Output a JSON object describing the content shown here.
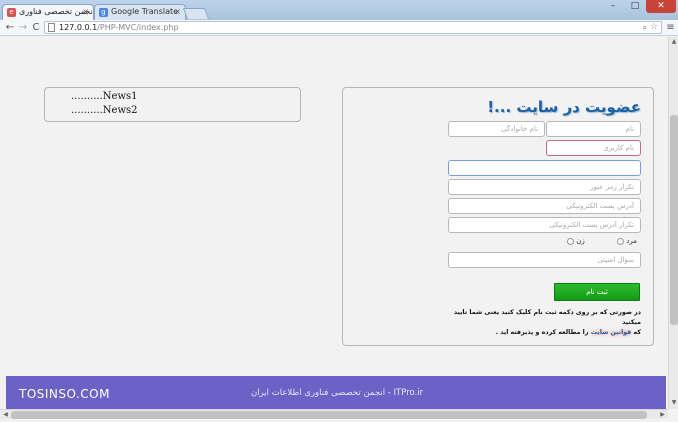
{
  "browser": {
    "tabs": [
      {
        "title": "انجمن تخصصی فناوری",
        "close": "×",
        "favicon": "e",
        "favicon_color": "#d9534f"
      },
      {
        "title": "Google Translate",
        "close": "×",
        "favicon": "g",
        "favicon_color": "#4a86e8"
      }
    ],
    "address_host": "127.0.0.1",
    "address_path": "/PHP-MVC/index.php",
    "nav": {
      "back": "←",
      "forward": "→",
      "reload": "C"
    },
    "window": {
      "minimize": "–",
      "maximize": "□",
      "close": "✕"
    },
    "menu_icon": "≡",
    "zoom_icon": "⌕",
    "star_icon": "☆"
  },
  "news": {
    "items": [
      "..........News1",
      "..........News2"
    ]
  },
  "register": {
    "title": "عضویت در سایت ...!",
    "placeholders": {
      "name": "نام",
      "family": "نام خانوادگی",
      "username": "نام کاربری",
      "password": "",
      "password_repeat": "تکرار رمز عبور",
      "email": "آدرس پست الکترونیکی",
      "email_repeat": "تکرار آدرس پست الکترونیکی",
      "security_question": "سوال امنیتی"
    },
    "gender": {
      "male": "مرد",
      "female": "زن"
    },
    "submit_label": "ثبت نام",
    "terms_line1": "در صورتی که بر روی دکمه ثبت نام کلیک کنید یعنی شما تایید میکنید",
    "terms_prefix": "که",
    "terms_link": "قوانین سایت",
    "terms_suffix": "را مطالعه کرده و پذیرفته اید ."
  },
  "footer": {
    "brand": "TOSINSO.COM",
    "site_text": "ITPro.ir - انجمن تخصصی فناوری اطلاعات ایران"
  },
  "colors": {
    "footer_bg": "#6c62c6",
    "submit_bg": "#1fab1f",
    "title_color": "#1f5fa3"
  }
}
